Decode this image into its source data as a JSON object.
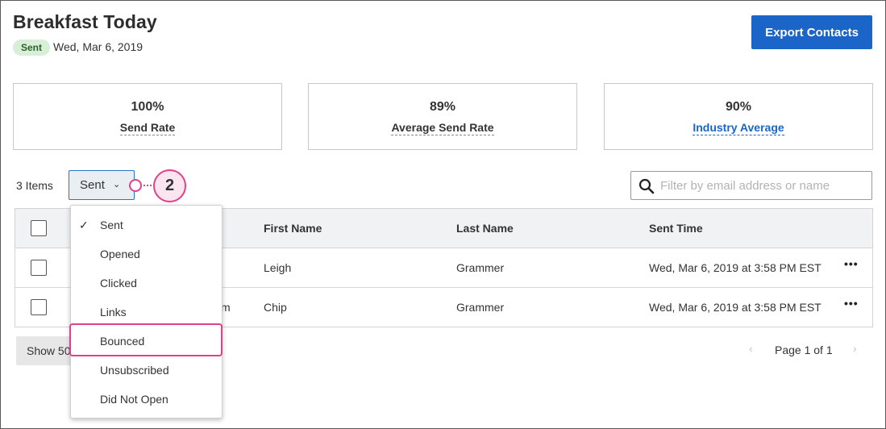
{
  "header": {
    "title": "Breakfast Today",
    "status_badge": "Sent",
    "date": "Wed, Mar 6, 2019",
    "export_label": "Export Contacts"
  },
  "stats": [
    {
      "value": "100%",
      "label": "Send Rate"
    },
    {
      "value": "89%",
      "label": "Average Send Rate"
    },
    {
      "value": "90%",
      "label": "Industry Average"
    }
  ],
  "toolbar": {
    "items_count": "3 Items",
    "filter_selected": "Sent",
    "callout_number": "2",
    "search_placeholder": "Filter by email address or name"
  },
  "table": {
    "columns": [
      "First Name",
      "Last Name",
      "Sent Time"
    ],
    "rows": [
      {
        "email_fragment": "",
        "first": "Leigh",
        "last": "Grammer",
        "sent_time": "Wed, Mar 6, 2019 at 3:58 PM EST"
      },
      {
        "email_fragment": "m",
        "first": "Chip",
        "last": "Grammer",
        "sent_time": "Wed, Mar 6, 2019 at 3:58 PM EST"
      }
    ]
  },
  "footer": {
    "show_label": "Show 50",
    "page_label": "Page 1 of 1"
  },
  "dropdown": {
    "items": [
      "Sent",
      "Opened",
      "Clicked",
      "Links",
      "Bounced",
      "Unsubscribed",
      "Did Not Open"
    ],
    "checked": "Sent",
    "highlighted": "Bounced"
  },
  "colors": {
    "accent": "#1a65c7",
    "callout": "#e2408c",
    "badge_bg": "#d6efd6"
  }
}
